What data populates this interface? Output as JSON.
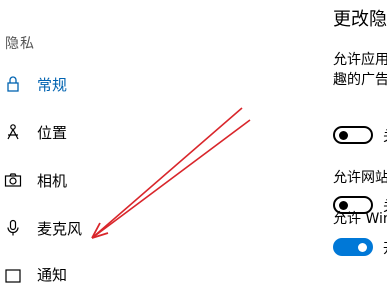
{
  "sidebar": {
    "section_heading": "隐私",
    "items": [
      {
        "label": "常规",
        "icon": "lock-icon",
        "active": true
      },
      {
        "label": "位置",
        "icon": "location-icon",
        "active": false
      },
      {
        "label": "相机",
        "icon": "camera-icon",
        "active": false
      },
      {
        "label": "麦克风",
        "icon": "microphone-icon",
        "active": false
      },
      {
        "label": "通知",
        "icon": "notification-icon",
        "active": false
      }
    ]
  },
  "panel": {
    "title": "更改隐",
    "settings": [
      {
        "text_line1": "允许应用",
        "text_line2": "趣的广告",
        "toggle": "off",
        "state_label": "关"
      },
      {
        "text_line1": "允许网站",
        "toggle": "off",
        "state_label": "关"
      },
      {
        "text_line1": "允许 Win",
        "toggle": "on",
        "state_label": "开"
      }
    ]
  },
  "colors": {
    "accent": "#0078d7",
    "active_text": "#0063b1",
    "annotation_arrow": "#d9262b"
  }
}
